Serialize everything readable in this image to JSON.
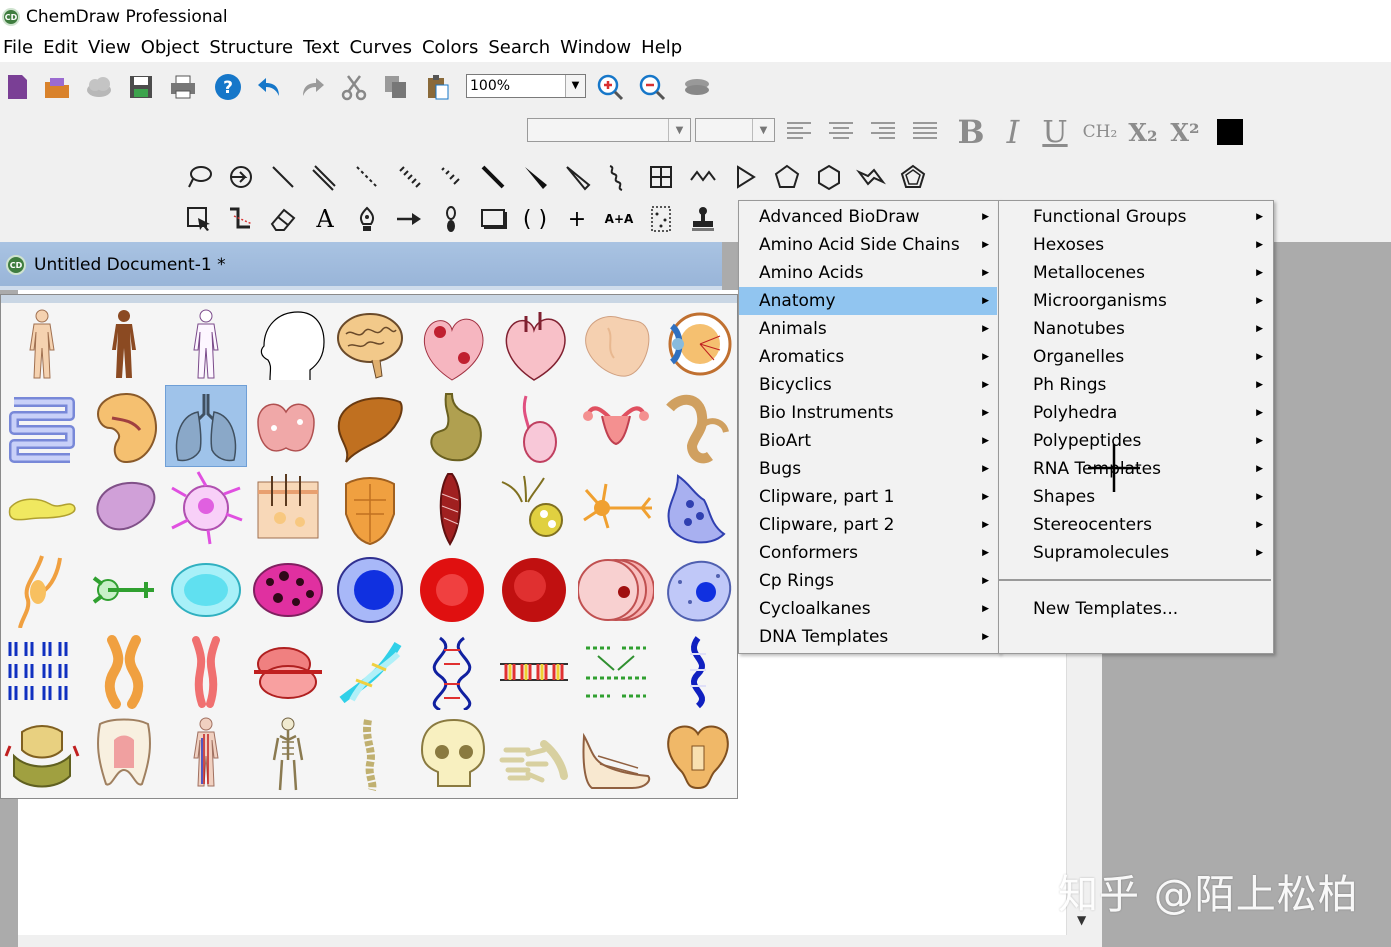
{
  "window": {
    "title": "ChemDraw Professional",
    "app_icon_text": "CD"
  },
  "menubar": {
    "items": [
      "File",
      "Edit",
      "View",
      "Object",
      "Structure",
      "Text",
      "Curves",
      "Colors",
      "Search",
      "Window",
      "Help"
    ]
  },
  "toolbar": {
    "zoom_value": "100%",
    "format": {
      "bold": "B",
      "italic": "I",
      "underline": "U",
      "formula": "CH₂",
      "subscript": "X₂",
      "superscript": "X²"
    },
    "text_tool": "A",
    "plus_tool": "+",
    "reaction_tool": "A+A",
    "brackets_tool": "( )"
  },
  "document": {
    "title": "Untitled Document-1 *",
    "icon_text": "CD"
  },
  "palette": {
    "selected": "lungs",
    "rows": [
      [
        "human-body-light",
        "human-body-dark",
        "human-body-outline",
        "head-profile",
        "brain",
        "heart-red",
        "heart-pink",
        "lobe-tissue",
        "eye"
      ],
      [
        "intestines",
        "kidney",
        "lungs",
        "thyroid",
        "liver",
        "stomach",
        "testis",
        "uterus",
        "ear"
      ],
      [
        "pancreas",
        "spleen",
        "cell-pink",
        "skin-section",
        "torso-muscles",
        "muscle-fiber",
        "neuron-yellow",
        "neuron-orange",
        "synapse"
      ],
      [
        "nerve-cell",
        "green-neuron",
        "epithelial-cell",
        "magenta-cell",
        "blue-cell",
        "red-blood-cell",
        "red-cell-dark",
        "cell-stack",
        "blue-spotted-cell"
      ],
      [
        "chromosomes",
        "chromosome-orange",
        "chromosome-pink",
        "ribosome",
        "dna-helix-cyan",
        "dna-helix",
        "dna-strand",
        "dna-base-pairs",
        "dna-blue"
      ],
      [
        "vertebra",
        "tooth",
        "circulatory-system",
        "skeleton",
        "spine",
        "skull",
        "hand-bones",
        "foot-bones",
        "pelvis"
      ]
    ]
  },
  "menus": {
    "primary": {
      "highlighted": "Anatomy",
      "items": [
        "Advanced BioDraw",
        "Amino Acid Side Chains",
        "Amino Acids",
        "Anatomy",
        "Animals",
        "Aromatics",
        "Bicyclics",
        "Bio Instruments",
        "BioArt",
        "Bugs",
        "Clipware, part 1",
        "Clipware, part 2",
        "Conformers",
        "Cp Rings",
        "Cycloalkanes",
        "DNA Templates"
      ]
    },
    "secondary": {
      "items": [
        "Functional Groups",
        "Hexoses",
        "Metallocenes",
        "Microorganisms",
        "Nanotubes",
        "Organelles",
        "Ph Rings",
        "Polyhedra",
        "Polypeptides",
        "RNA Templates",
        "Shapes",
        "Stereocenters",
        "Supramolecules"
      ],
      "extra": "New Templates..."
    }
  },
  "watermark": "知乎 @陌上松柏",
  "colors": {
    "menu_highlight": "#91c5f0",
    "selected_cell": "#9fc3ea",
    "titlebar_doc": "#a9c3e2"
  }
}
